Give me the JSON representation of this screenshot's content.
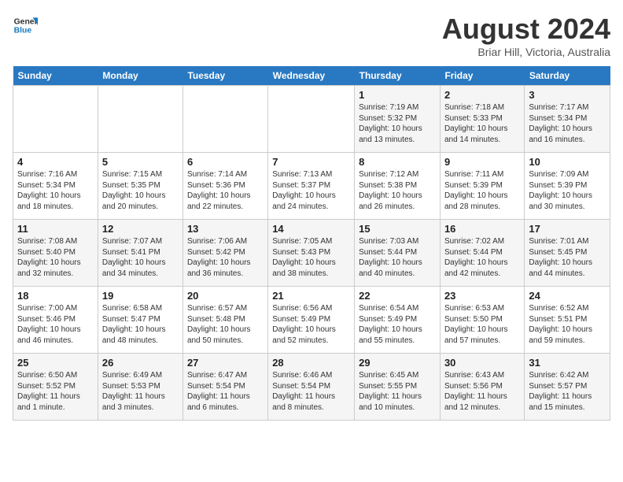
{
  "logo": {
    "line1": "General",
    "line2": "Blue"
  },
  "title": "August 2024",
  "subtitle": "Briar Hill, Victoria, Australia",
  "days_of_week": [
    "Sunday",
    "Monday",
    "Tuesday",
    "Wednesday",
    "Thursday",
    "Friday",
    "Saturday"
  ],
  "weeks": [
    [
      {
        "day": "",
        "info": ""
      },
      {
        "day": "",
        "info": ""
      },
      {
        "day": "",
        "info": ""
      },
      {
        "day": "",
        "info": ""
      },
      {
        "day": "1",
        "info": "Sunrise: 7:19 AM\nSunset: 5:32 PM\nDaylight: 10 hours\nand 13 minutes."
      },
      {
        "day": "2",
        "info": "Sunrise: 7:18 AM\nSunset: 5:33 PM\nDaylight: 10 hours\nand 14 minutes."
      },
      {
        "day": "3",
        "info": "Sunrise: 7:17 AM\nSunset: 5:34 PM\nDaylight: 10 hours\nand 16 minutes."
      }
    ],
    [
      {
        "day": "4",
        "info": "Sunrise: 7:16 AM\nSunset: 5:34 PM\nDaylight: 10 hours\nand 18 minutes."
      },
      {
        "day": "5",
        "info": "Sunrise: 7:15 AM\nSunset: 5:35 PM\nDaylight: 10 hours\nand 20 minutes."
      },
      {
        "day": "6",
        "info": "Sunrise: 7:14 AM\nSunset: 5:36 PM\nDaylight: 10 hours\nand 22 minutes."
      },
      {
        "day": "7",
        "info": "Sunrise: 7:13 AM\nSunset: 5:37 PM\nDaylight: 10 hours\nand 24 minutes."
      },
      {
        "day": "8",
        "info": "Sunrise: 7:12 AM\nSunset: 5:38 PM\nDaylight: 10 hours\nand 26 minutes."
      },
      {
        "day": "9",
        "info": "Sunrise: 7:11 AM\nSunset: 5:39 PM\nDaylight: 10 hours\nand 28 minutes."
      },
      {
        "day": "10",
        "info": "Sunrise: 7:09 AM\nSunset: 5:39 PM\nDaylight: 10 hours\nand 30 minutes."
      }
    ],
    [
      {
        "day": "11",
        "info": "Sunrise: 7:08 AM\nSunset: 5:40 PM\nDaylight: 10 hours\nand 32 minutes."
      },
      {
        "day": "12",
        "info": "Sunrise: 7:07 AM\nSunset: 5:41 PM\nDaylight: 10 hours\nand 34 minutes."
      },
      {
        "day": "13",
        "info": "Sunrise: 7:06 AM\nSunset: 5:42 PM\nDaylight: 10 hours\nand 36 minutes."
      },
      {
        "day": "14",
        "info": "Sunrise: 7:05 AM\nSunset: 5:43 PM\nDaylight: 10 hours\nand 38 minutes."
      },
      {
        "day": "15",
        "info": "Sunrise: 7:03 AM\nSunset: 5:44 PM\nDaylight: 10 hours\nand 40 minutes."
      },
      {
        "day": "16",
        "info": "Sunrise: 7:02 AM\nSunset: 5:44 PM\nDaylight: 10 hours\nand 42 minutes."
      },
      {
        "day": "17",
        "info": "Sunrise: 7:01 AM\nSunset: 5:45 PM\nDaylight: 10 hours\nand 44 minutes."
      }
    ],
    [
      {
        "day": "18",
        "info": "Sunrise: 7:00 AM\nSunset: 5:46 PM\nDaylight: 10 hours\nand 46 minutes."
      },
      {
        "day": "19",
        "info": "Sunrise: 6:58 AM\nSunset: 5:47 PM\nDaylight: 10 hours\nand 48 minutes."
      },
      {
        "day": "20",
        "info": "Sunrise: 6:57 AM\nSunset: 5:48 PM\nDaylight: 10 hours\nand 50 minutes."
      },
      {
        "day": "21",
        "info": "Sunrise: 6:56 AM\nSunset: 5:49 PM\nDaylight: 10 hours\nand 52 minutes."
      },
      {
        "day": "22",
        "info": "Sunrise: 6:54 AM\nSunset: 5:49 PM\nDaylight: 10 hours\nand 55 minutes."
      },
      {
        "day": "23",
        "info": "Sunrise: 6:53 AM\nSunset: 5:50 PM\nDaylight: 10 hours\nand 57 minutes."
      },
      {
        "day": "24",
        "info": "Sunrise: 6:52 AM\nSunset: 5:51 PM\nDaylight: 10 hours\nand 59 minutes."
      }
    ],
    [
      {
        "day": "25",
        "info": "Sunrise: 6:50 AM\nSunset: 5:52 PM\nDaylight: 11 hours\nand 1 minute."
      },
      {
        "day": "26",
        "info": "Sunrise: 6:49 AM\nSunset: 5:53 PM\nDaylight: 11 hours\nand 3 minutes."
      },
      {
        "day": "27",
        "info": "Sunrise: 6:47 AM\nSunset: 5:54 PM\nDaylight: 11 hours\nand 6 minutes."
      },
      {
        "day": "28",
        "info": "Sunrise: 6:46 AM\nSunset: 5:54 PM\nDaylight: 11 hours\nand 8 minutes."
      },
      {
        "day": "29",
        "info": "Sunrise: 6:45 AM\nSunset: 5:55 PM\nDaylight: 11 hours\nand 10 minutes."
      },
      {
        "day": "30",
        "info": "Sunrise: 6:43 AM\nSunset: 5:56 PM\nDaylight: 11 hours\nand 12 minutes."
      },
      {
        "day": "31",
        "info": "Sunrise: 6:42 AM\nSunset: 5:57 PM\nDaylight: 11 hours\nand 15 minutes."
      }
    ]
  ]
}
